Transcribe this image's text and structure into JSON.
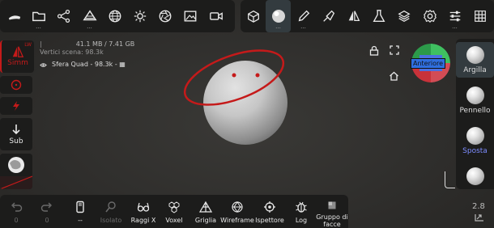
{
  "colors": {
    "accent_red": "#c51a1a",
    "accent_blue": "#5b7bff",
    "panel": "#1c1c1b",
    "selection": "#333b3f"
  },
  "top_left_tools": [
    {
      "icon": "brush-stroke-icon"
    },
    {
      "icon": "folder-icon"
    },
    {
      "icon": "share-nodes-icon"
    },
    {
      "icon": "layers-stack-icon"
    },
    {
      "icon": "globe-grid-icon"
    },
    {
      "icon": "sun-icon"
    },
    {
      "icon": "aperture-icon"
    },
    {
      "icon": "image-icon"
    },
    {
      "icon": "video-camera-icon"
    }
  ],
  "top_right_tools": [
    {
      "icon": "cube-transform-icon"
    },
    {
      "icon": "material-sphere-icon"
    },
    {
      "icon": "pencil-icon"
    },
    {
      "icon": "brush-icon"
    },
    {
      "icon": "symmetry-icon"
    },
    {
      "icon": "flask-icon"
    },
    {
      "icon": "layers-icon"
    },
    {
      "icon": "gear-icon"
    },
    {
      "icon": "sliders-icon"
    },
    {
      "icon": "grid-icon"
    }
  ],
  "info": {
    "line1_prefix": "|",
    "memory": "41.1 MB / 7.41 GB",
    "scene_vertices": "Vertici scena: 98.3k",
    "object": "Sfera Quad - 98.3k - ▦"
  },
  "left_panel": {
    "symmetry_badge": "LW",
    "symmetry_label": "Simm",
    "sub_label": "Sub"
  },
  "right_panel": {
    "materials": [
      {
        "label": "Argilla"
      },
      {
        "label": "Pennello"
      },
      {
        "label": "Sposta"
      },
      {
        "label": ""
      }
    ]
  },
  "gizmo": {
    "face_label": "Anteriore"
  },
  "bottom_bar": [
    {
      "label": "0",
      "icon": "undo-icon",
      "disabled": true
    },
    {
      "label": "0",
      "icon": "redo-icon",
      "disabled": true
    },
    {
      "label": "--",
      "icon": "phone-icon",
      "disabled": false
    },
    {
      "label": "Isolato",
      "icon": "isolate-icon",
      "disabled": true
    },
    {
      "label": "Raggi X",
      "icon": "xray-glasses-icon",
      "disabled": false
    },
    {
      "label": "Voxel",
      "icon": "voxel-icon",
      "disabled": false
    },
    {
      "label": "Griglia",
      "icon": "grid-triangle-icon",
      "disabled": false
    },
    {
      "label": "Wireframe",
      "icon": "wireframe-icon",
      "disabled": false
    },
    {
      "label": "Ispettore",
      "icon": "inspector-icon",
      "disabled": false
    },
    {
      "label": "Log",
      "icon": "bug-icon",
      "disabled": false
    },
    {
      "label": "Gruppo di facce",
      "icon": "face-group-icon",
      "disabled": false
    }
  ],
  "version": "2.8"
}
